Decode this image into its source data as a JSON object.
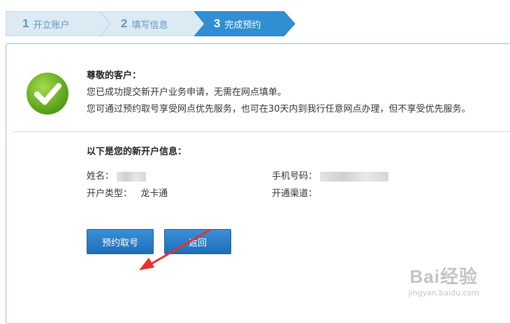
{
  "steps": [
    {
      "num": "1",
      "label": "开立账户"
    },
    {
      "num": "2",
      "label": "填写信息"
    },
    {
      "num": "3",
      "label": "完成预约"
    }
  ],
  "message": {
    "greeting": "尊敬的客户：",
    "line1": "您已成功提交新开户业务申请，无需在网点填单。",
    "line2": "您可通过预约取号享受网点优先服务，也可在30天内到我行任意网点办理，但不享受优先服务。"
  },
  "account_info": {
    "title": "以下是您的新开户信息：",
    "name_label": "姓名：",
    "name_value": "",
    "phone_label": "手机号码：",
    "phone_value": "",
    "type_label": "开户类型：",
    "type_value": "龙卡通",
    "channel_label": "开通渠道：",
    "channel_value": ""
  },
  "buttons": {
    "reserve": "预约取号",
    "back": "返回"
  },
  "watermark": {
    "logo": "Bai经验",
    "url": "jingyan.baidu.com"
  },
  "colors": {
    "active_step": "#2f8fd2",
    "inactive_step": "#dceaf4",
    "button": "#2a7fc9",
    "check_green": "#6ab023",
    "arrow": "#e8302c"
  }
}
